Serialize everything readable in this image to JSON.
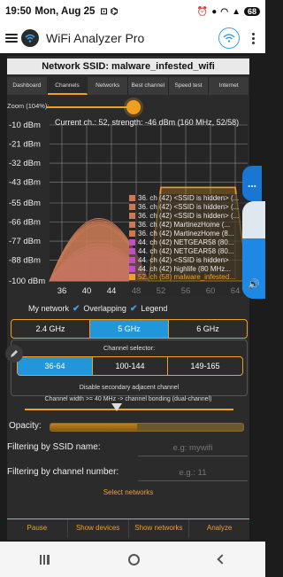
{
  "status_bar": {
    "time": "19:50",
    "date": "Mon, Aug 25",
    "battery": "68"
  },
  "app_bar": {
    "title": "WiFi Analyzer Pro"
  },
  "ssid_header": "Network SSID: malware_infested_wifi",
  "tabs": [
    {
      "label": "Dashboard",
      "active": false
    },
    {
      "label": "Channels",
      "active": true
    },
    {
      "label": "Networks",
      "active": false
    },
    {
      "label": "Best channel",
      "active": false
    },
    {
      "label": "Speed test",
      "active": false
    },
    {
      "label": "Internet",
      "active": false
    }
  ],
  "zoom": {
    "label": "Zoom (104%):",
    "value_percent": 104
  },
  "chart_header": "Current ch.: 52, strength: -46 dBm (160 MHz, 52/58)",
  "chart_data": {
    "type": "area",
    "x_ticks": [
      "36",
      "40",
      "44",
      "48",
      "52",
      "56",
      "60",
      "64"
    ],
    "y_ticks": [
      "-10 dBm",
      "-21 dBm",
      "-32 dBm",
      "-43 dBm",
      "-55 dBm",
      "-66 dBm",
      "-77 dBm",
      "-88 dBm",
      "-100 dBm"
    ],
    "xlim": [
      34,
      66
    ],
    "ylim": [
      -100,
      -10
    ],
    "series": [
      {
        "name": "36. ch (42) <SSID is hidden> (...",
        "color": "#c87a55",
        "center": 42,
        "half_width": 8,
        "peak": -63
      },
      {
        "name": "36. ch (42) <SSID is hidden> (...",
        "color": "#c87a55",
        "center": 42,
        "half_width": 8,
        "peak": -64
      },
      {
        "name": "36. ch (42) <SSID is hidden> (...",
        "color": "#c87a55",
        "center": 42,
        "half_width": 8,
        "peak": -65
      },
      {
        "name": "36. ch (42) MartinezHome (...",
        "color": "#c87a55",
        "center": 42,
        "half_width": 8,
        "peak": -66
      },
      {
        "name": "36. ch (42) MartinezHome (8...",
        "color": "#c87a55",
        "center": 42,
        "half_width": 8,
        "peak": -67
      },
      {
        "name": "44. ch (42) NETGEAR58 (80...",
        "color": "#c050c0",
        "center": 42,
        "half_width": 8,
        "peak": -78
      },
      {
        "name": "44. ch (42) NETGEAR58 (80...",
        "color": "#c050c0",
        "center": 42,
        "half_width": 8,
        "peak": -80
      },
      {
        "name": "44. ch (42) <SSID is hidden>",
        "color": "#c050c0",
        "center": 42,
        "half_width": 8,
        "peak": -82
      },
      {
        "name": "44. ch (42) highlife (80 MHz...",
        "color": "#c050c0",
        "center": 42,
        "half_width": 8,
        "peak": -84
      },
      {
        "name": "52. ch (58) malware_infested...",
        "color": "#f0a020",
        "center": 58,
        "half_width": 8,
        "peak": -46,
        "highlight": true
      }
    ]
  },
  "checks": [
    {
      "label": "My network",
      "checked": false
    },
    {
      "label": "Overlapping",
      "checked": true
    },
    {
      "label": "Legend",
      "checked": true
    }
  ],
  "bands": [
    {
      "label": "2.4 GHz",
      "active": false
    },
    {
      "label": "5 GHz",
      "active": true
    },
    {
      "label": "6 GHz",
      "active": false
    }
  ],
  "channel_selector": {
    "label": "Channel selector:",
    "options": [
      {
        "label": "36-64",
        "active": true
      },
      {
        "label": "100-144",
        "active": false
      },
      {
        "label": "149-165",
        "active": false
      }
    ],
    "disable_adjacent": "Disable secondary adjacent channel"
  },
  "channel_width": {
    "label": "Channel width >= 40 MHz -> channel bonding (dual-channel)"
  },
  "opacity": {
    "label": "Opacity:",
    "value_fraction": 0.45
  },
  "filter_ssid": {
    "label": "Filtering by SSID name:",
    "placeholder": "e.g: mywifi"
  },
  "filter_channel": {
    "label": "Filtering by channel number:",
    "placeholder": "e.g.: 11"
  },
  "select_networks": "Select networks",
  "bottom_buttons": [
    "Pause",
    "Show devices",
    "Show networks",
    "Analyze"
  ],
  "side_widget": {
    "label": "..."
  },
  "colors": {
    "accent": "#f0a020",
    "selected": "#2196d9",
    "background": "#2b2b2b"
  }
}
